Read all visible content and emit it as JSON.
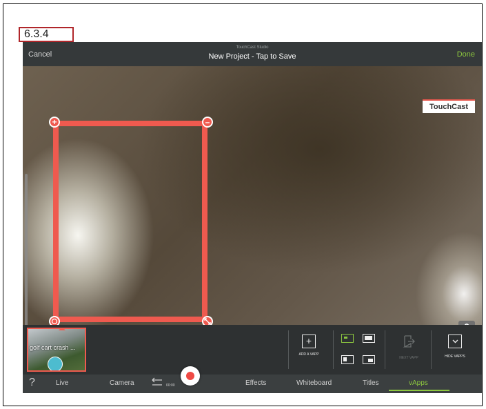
{
  "section_label": "6.3.4",
  "topbar": {
    "cancel_label": "Cancel",
    "studio_label": "TouchCast Studio",
    "title": "New Project - Tap to Save",
    "done_label": "Done"
  },
  "camera": {
    "watermark": "TouchCast",
    "selection_handles": [
      "plus-icon",
      "minus-icon",
      "target-icon",
      "resize-icon"
    ],
    "mic_icon": "microphone-icon"
  },
  "tray": {
    "vapp_thumbnail_label": "golf cart crash ...",
    "tools": {
      "add_vapp_label": "ADD A VAPP",
      "next_vapp_label": "NEXT VAPP",
      "hide_vapps_label": "HIDE VAPPS"
    }
  },
  "bottombar": {
    "help_label": "?",
    "tabs": {
      "live": "Live",
      "camera": "Camera",
      "effects": "Effects",
      "whiteboard": "Whiteboard",
      "titles": "Titles",
      "vapps": "vApps"
    },
    "timer": "00:00",
    "active_tab": "vApps"
  },
  "colors": {
    "accent_green": "#8cc63f",
    "selection_red": "#ef5a4f",
    "label_border": "#b0262a"
  }
}
